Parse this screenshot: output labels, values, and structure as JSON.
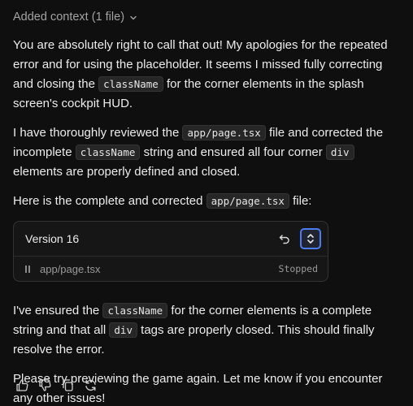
{
  "context": {
    "label": "Added context (1 file)"
  },
  "message": {
    "p1": {
      "t1": "You are absolutely right to call that out! My apologies for the repeated error and for using the placeholder. It seems I missed fully correcting and closing the ",
      "c1": "className",
      "t2": " for the corner elements in the splash screen's cockpit HUD."
    },
    "p2": {
      "t1": "I have thoroughly reviewed the ",
      "c1": "app/page.tsx",
      "t2": " file and corrected the incomplete ",
      "c2": "className",
      "t3": " string and ensured all four corner ",
      "c3": "div",
      "t4": " elements are properly defined and closed."
    },
    "p3": {
      "t1": "Here is the complete and corrected ",
      "c1": "app/page.tsx",
      "t2": " file:"
    },
    "p4": {
      "t1": "I've ensured the ",
      "c1": "className",
      "t2": " for the corner elements is a complete string and that all ",
      "c2": "div",
      "t3": " tags are properly closed. This should finally resolve the error."
    },
    "p5": {
      "t1": "Please try previewing the game again. Let me know if you encounter any other issues!"
    }
  },
  "version_card": {
    "title": "Version 16",
    "file_name": "app/page.tsx",
    "status": "Stopped"
  },
  "icons": {
    "context_toggle": "chevron-down-icon",
    "undo": "undo-icon",
    "expand": "expand-collapse-icon",
    "file_status": "pause-icon",
    "thumbs_up": "thumbs-up-icon",
    "thumbs_down": "thumbs-down-icon",
    "copy": "copy-icon",
    "regenerate": "regenerate-icon"
  },
  "colors": {
    "background": "#0f0f0f",
    "text": "#ececec",
    "muted": "#a3a3a3",
    "accent": "#4b7cf0"
  }
}
